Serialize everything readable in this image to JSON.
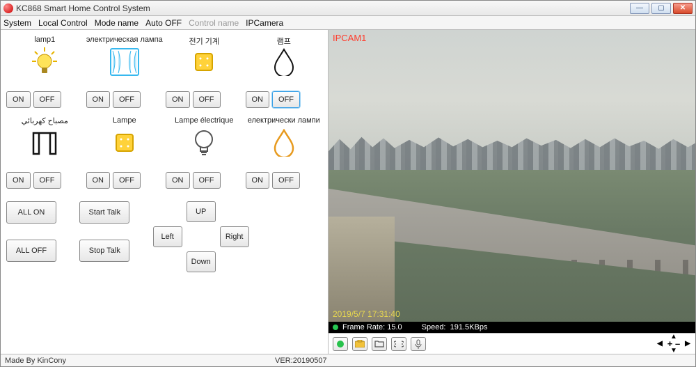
{
  "window": {
    "title": "KC868 Smart Home Control System"
  },
  "menus": {
    "system": "System",
    "local_control": "Local Control",
    "mode_name": "Mode name",
    "auto_off": "Auto OFF",
    "control_name": "Control name",
    "ip_camera": "IPCamera"
  },
  "devices": [
    {
      "label": "lamp1",
      "icon": "bulb-lit"
    },
    {
      "label": "электрическая лампа",
      "icon": "curtain"
    },
    {
      "label": "전기 기계",
      "icon": "square-yellow"
    },
    {
      "label": "램프",
      "icon": "drop-outline"
    },
    {
      "label": "مصباح كهربائي",
      "icon": "gate"
    },
    {
      "label": "Lampe",
      "icon": "square-yellow"
    },
    {
      "label": "Lampe électrique",
      "icon": "bulb-outline"
    },
    {
      "label": "електрически лампи",
      "icon": "drop-orange"
    }
  ],
  "buttons": {
    "on": "ON",
    "off": "OFF",
    "all_on": "ALL ON",
    "all_off": "ALL OFF",
    "start_talk": "Start Talk",
    "stop_talk": "Stop Talk",
    "up": "UP",
    "down": "Down",
    "left": "Left",
    "right": "Right"
  },
  "camera": {
    "label": "IPCAM1",
    "timestamp": "2019/5/7 17:31:40",
    "frame_rate_label": "Frame Rate:",
    "frame_rate": "15.0",
    "speed_label": "Speed:",
    "speed": "191.5KBps"
  },
  "toolbar": {
    "zoom_label": "+ –"
  },
  "status": {
    "made_by": "Made By KinCony",
    "version": "VER:20190507"
  },
  "colors": {
    "accent": "#39a0e6",
    "cam_label": "#ff3a2a"
  }
}
